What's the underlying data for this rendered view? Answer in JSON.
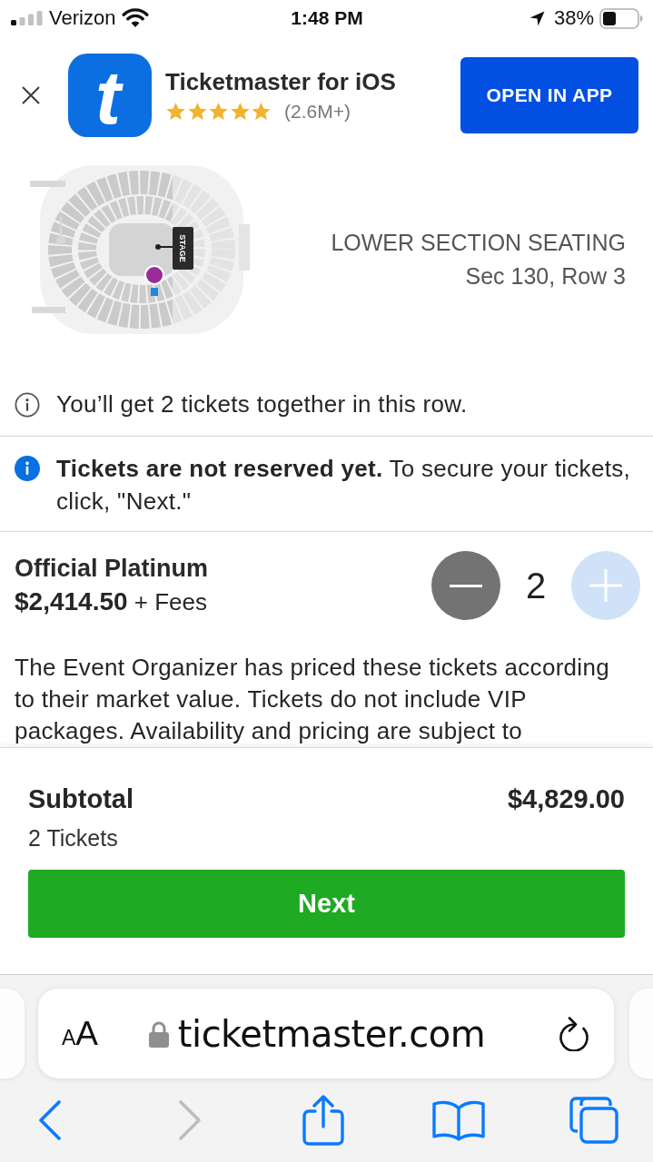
{
  "status_bar": {
    "carrier": "Verizon",
    "time": "1:48 PM",
    "battery": "38%"
  },
  "app_banner": {
    "logo_letter": "t",
    "title": "Ticketmaster for iOS",
    "stars": 5,
    "rating_count": "(2.6M+)",
    "button": "OPEN IN APP"
  },
  "seat_map": {
    "stage_label": "STAGE",
    "section": "LOWER SECTION SEATING",
    "seat": "Sec 130, Row 3"
  },
  "notices": [
    {
      "kind": "info",
      "text": "You’ll get 2 tickets together in this row."
    },
    {
      "kind": "alert",
      "text": "**Tickets are not reserved yet.** To secure your tickets, click, \"Next.\""
    }
  ],
  "ticket": {
    "name": "Official Platinum",
    "price": "$2,414.50",
    "fees": "+ Fees",
    "quantity": "2",
    "decrease": {
      "disabled": false
    },
    "increase": {
      "disabled": true
    },
    "description": "The Event Organizer has priced these tickets according to their market value. Tickets do not include VIP packages. Availability and pricing are subject to"
  },
  "subtotal": {
    "label": "Subtotal",
    "amount": "$4,829.00",
    "count": "2 Tickets",
    "button": "Next"
  },
  "browser": {
    "text_size_button": "AA",
    "url": "ticketmaster.com",
    "back": {
      "disabled": false
    },
    "forward": {
      "disabled": true
    }
  }
}
